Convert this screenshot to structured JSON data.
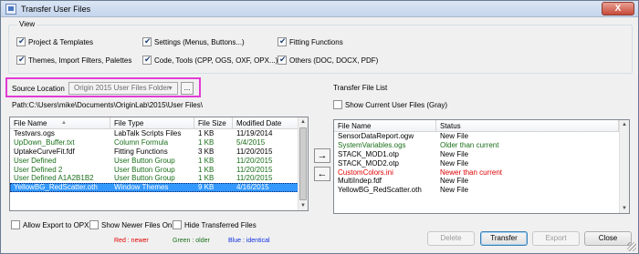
{
  "window": {
    "title": "Transfer User Files",
    "close_label": "X"
  },
  "view": {
    "legend": "View",
    "options": [
      {
        "label": "Project & Templates",
        "checked": true
      },
      {
        "label": "Settings (Menus, Buttons...)",
        "checked": true
      },
      {
        "label": "Fitting Functions",
        "checked": true
      },
      {
        "label": "Themes, Import Filters, Palettes",
        "checked": true
      },
      {
        "label": "Code, Tools (CPP, OGS, OXF, OPX...)",
        "checked": true
      },
      {
        "label": "Others (DOC, DOCX, PDF)",
        "checked": true
      }
    ]
  },
  "source": {
    "label": "Source Location",
    "selected": "Origin 2015 User Files Folder",
    "browse_label": "...",
    "path": "Path:C:\\Users\\mike\\Documents\\OriginLab\\2015\\User Files\\"
  },
  "left_list": {
    "columns": [
      "File Name",
      "File Type",
      "File Size",
      "Modified Date"
    ],
    "rows": [
      {
        "name": "Testvars.ogs",
        "type": "LabTalk Scripts Files",
        "size": "1 KB",
        "date": "11/19/2014",
        "color": "#000000"
      },
      {
        "name": "UpDown_Buffer.txt",
        "type": "Column Formula",
        "size": "1 KB",
        "date": "5/4/2015",
        "color": "#1a6f1a"
      },
      {
        "name": "UptakeCurveFit.fdf",
        "type": "Fitting Functions",
        "size": "3 KB",
        "date": "11/20/2015",
        "color": "#000000"
      },
      {
        "name": "User Defined",
        "type": "User Button Group",
        "size": "1 KB",
        "date": "11/20/2015",
        "color": "#1a6f1a"
      },
      {
        "name": "User Defined 2",
        "type": "User Button Group",
        "size": "1 KB",
        "date": "11/20/2015",
        "color": "#1a6f1a"
      },
      {
        "name": "User Defined A1A2B1B2",
        "type": "User Button Group",
        "size": "1 KB",
        "date": "11/20/2015",
        "color": "#1a6f1a"
      },
      {
        "name": "YellowBG_RedScatter.oth",
        "type": "Window Themes",
        "size": "9 KB",
        "date": "4/16/2015",
        "color": "#ffffff",
        "selected": true
      }
    ]
  },
  "transfer": {
    "label": "Transfer File List",
    "show_current_label": "Show Current User Files (Gray)",
    "show_current_checked": false,
    "move_right": "→",
    "move_left": "←",
    "columns": [
      "File Name",
      "Status"
    ],
    "rows": [
      {
        "name": "SensorDataReport.ogw",
        "status": "New File",
        "color": "#000000"
      },
      {
        "name": "SystemVariables.ogs",
        "status": "Older than current",
        "color": "#1a6f1a"
      },
      {
        "name": "STACK_MOD1.otp",
        "status": "New File",
        "color": "#000000"
      },
      {
        "name": "STACK_MOD2.otp",
        "status": "New File",
        "color": "#000000"
      },
      {
        "name": "CustomColors.ini",
        "status": "Newer than current",
        "color": "#e00000"
      },
      {
        "name": "MultiIndep.fdf",
        "status": "New File",
        "color": "#000000"
      },
      {
        "name": "YellowBG_RedScatter.oth",
        "status": "New File",
        "color": "#000000"
      }
    ]
  },
  "bottom_options": [
    {
      "label": "Allow Export to OPX",
      "checked": false
    },
    {
      "label": "Show Newer Files Only",
      "checked": false
    },
    {
      "label": "Hide Transferred Files",
      "checked": false
    }
  ],
  "legend": {
    "red": "Red : newer",
    "green": "Green : older",
    "blue": "Blue : identical",
    "red_color": "#e00000",
    "green_color": "#1a6f1a",
    "blue_color": "#1030e0"
  },
  "buttons": {
    "delete": "Delete",
    "transfer": "Transfer",
    "export": "Export",
    "close": "Close"
  }
}
